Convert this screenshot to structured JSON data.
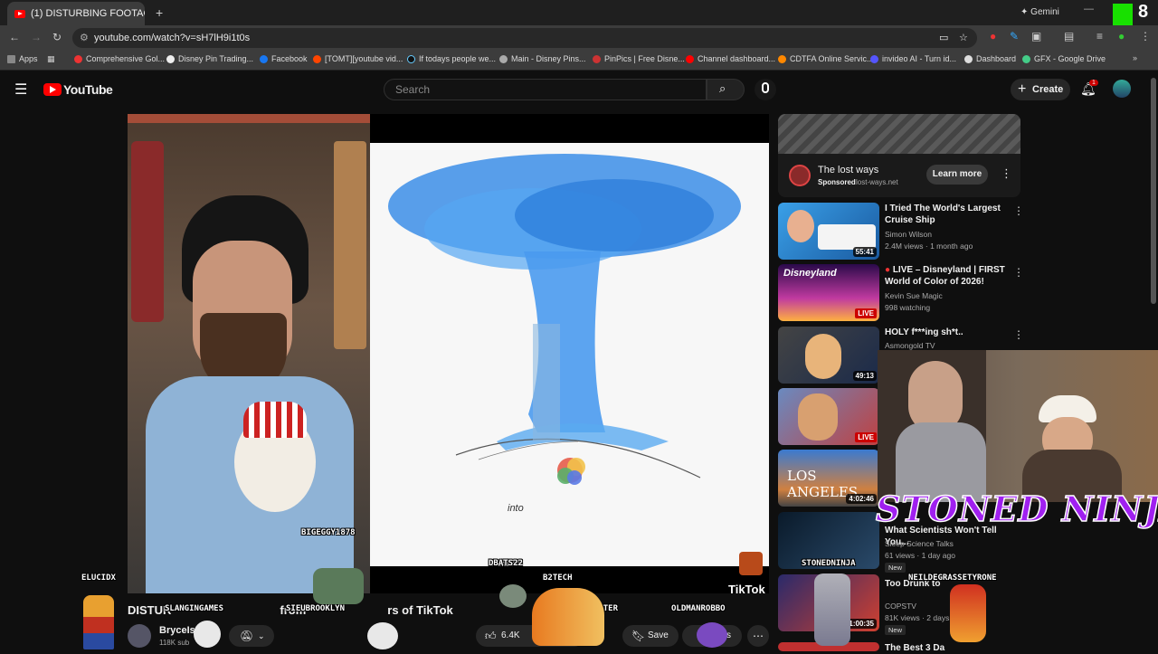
{
  "browser": {
    "tab_title": "(1) DISTURBING FOOTAGE",
    "url": "youtube.com/watch?v=sH7lH9i1t0s",
    "profile_label": "Gemini",
    "bookmarks": [
      "Apps",
      "Comprehensive Gol...",
      "Disney Pin Trading...",
      "Facebook",
      "[TOMT][youtube vid...",
      "If todays people we...",
      "Main - Disney Pins...",
      "PinPics | Free Disne...",
      "Channel dashboard...",
      "CDTFA Online Servic...",
      "invideo AI - Turn id...",
      "Dashboard",
      "GFX - Google Drive"
    ]
  },
  "header": {
    "logo_text": "YouTube",
    "search_placeholder": "Search",
    "create_label": "Create",
    "notification_count": "1"
  },
  "player": {
    "caption": "into",
    "tiktok_watermark": "TikTok",
    "webcam_tag": "BIGEGGY1878",
    "video_title_visible": "DISTUR",
    "video_title_tail": "from",
    "video_title_end": "rs of TikTok",
    "channel_name": "BryceIsRi",
    "subscriber_count": "118K sub",
    "like_count": "6.4K",
    "save_label": "Save",
    "clips_label": "ks"
  },
  "ad": {
    "title": "The lost ways",
    "sponsored": "Sponsored",
    "domain": "lost-ways.net",
    "cta": "Learn more"
  },
  "recommendations": [
    {
      "title": "I Tried The World's Largest Cruise Ship",
      "channel": "Simon Wilson",
      "meta": "2.4M views · 1 month ago",
      "duration": "55:41"
    },
    {
      "title": "LIVE – Disneyland | FIRST World of Color of 2026!",
      "channel": "Kevin Sue Magic",
      "meta": "998 watching",
      "badge": "LIVE"
    },
    {
      "title": "HOLY f***ing sh*t..",
      "channel": "Asmongold TV",
      "meta": "",
      "duration": "49:13"
    },
    {
      "title": "",
      "channel": "",
      "meta": "",
      "badge": "LIVE"
    },
    {
      "title": "",
      "channel": "",
      "meta": "",
      "duration": "4:02:46"
    },
    {
      "title": "What Scientists Won't Tell You...",
      "channel": "Sleep Science Talks",
      "meta": "61 views · 1 day ago",
      "new": "New"
    },
    {
      "title": "Too Drunk to",
      "channel": "COPSTV",
      "meta": "81K views · 2 days ag",
      "new": "New",
      "duration": "1:00:35"
    },
    {
      "title": "The Best 3 Da",
      "channel": "",
      "meta": ""
    }
  ],
  "overlays": {
    "stoned_ninja": "STONED NINJA",
    "viewer_names": [
      "ELUCIDX",
      "SLANGINGAMES",
      "SIEUBROOKLYN",
      "DBATS22",
      "B2TECH",
      "NELLYMIESTER",
      "OLDMANROBBO",
      "STONEDNINJA",
      "NEILDEGRASSETYRONE"
    ]
  },
  "colors": {
    "yt_red": "#ff0000",
    "bg": "#0f0f0f",
    "stoned_purple": "#a020f0"
  }
}
